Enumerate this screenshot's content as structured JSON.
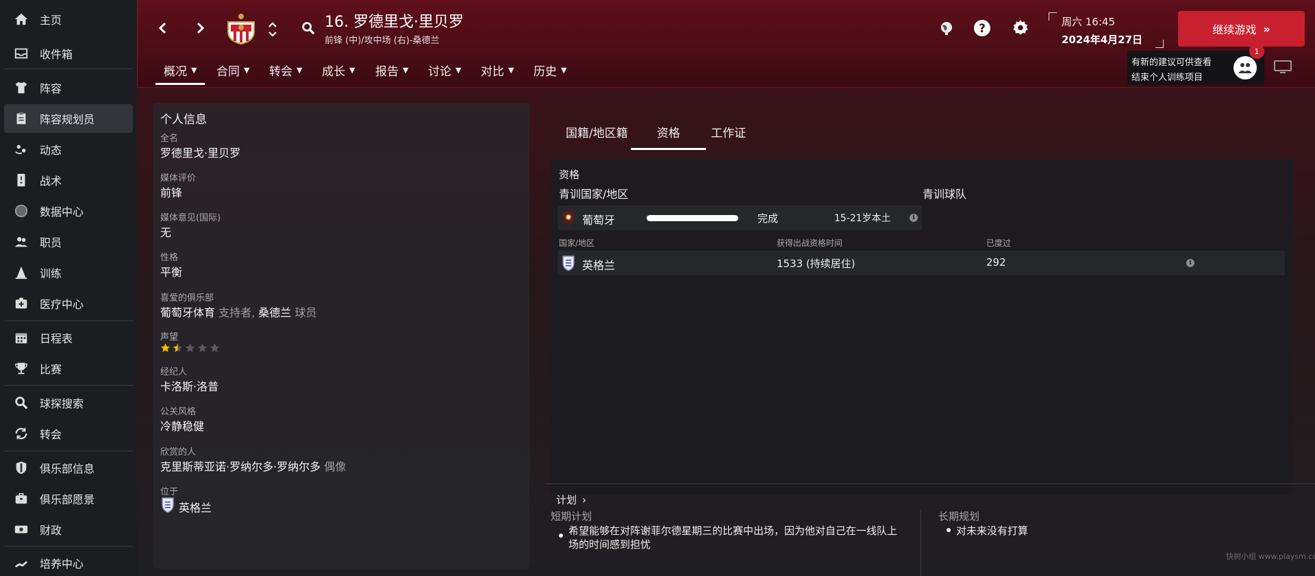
{
  "sidebar": {
    "items": [
      {
        "label": "主页",
        "icon": "home-icon"
      },
      {
        "label": "收件箱",
        "icon": "inbox-icon"
      },
      {
        "label": "阵容",
        "icon": "shirt-icon"
      },
      {
        "label": "阵容规划员",
        "icon": "clipboard-icon"
      },
      {
        "label": "动态",
        "icon": "dynamics-icon"
      },
      {
        "label": "战术",
        "icon": "tactics-board-icon"
      },
      {
        "label": "数据中心",
        "icon": "data-hub-icon"
      },
      {
        "label": "职员",
        "icon": "staff-icon"
      },
      {
        "label": "训练",
        "icon": "training-cone-icon"
      },
      {
        "label": "医疗中心",
        "icon": "medical-kit-icon"
      },
      {
        "label": "日程表",
        "icon": "calendar-icon"
      },
      {
        "label": "比赛",
        "icon": "trophy-icon"
      },
      {
        "label": "球探搜索",
        "icon": "search-icon"
      },
      {
        "label": "转会",
        "icon": "transfer-arrows-icon"
      },
      {
        "label": "俱乐部信息",
        "icon": "club-shield-icon"
      },
      {
        "label": "俱乐部愿景",
        "icon": "briefcase-icon"
      },
      {
        "label": "财政",
        "icon": "money-icon"
      },
      {
        "label": "培养中心",
        "icon": "development-chart-icon"
      }
    ]
  },
  "header": {
    "player_title": "16. 罗德里戈·里贝罗",
    "player_subtitle": "前锋 (中)/攻中场 (右)-桑德兰",
    "day_time": "周六 16:45",
    "date": "2024年4月27日",
    "continue_label": "继续游戏",
    "notice_line1": "有新的建议可供查看",
    "notice_line2": "结束个人训练项目",
    "notice_badge": "1",
    "tabs": [
      "概况",
      "合同",
      "转会",
      "成长",
      "报告",
      "讨论",
      "对比",
      "历史"
    ]
  },
  "personal": {
    "section_title": "个人信息",
    "full_name_label": "全名",
    "full_name": "罗德里戈·里贝罗",
    "media_rating_label": "媒体评价",
    "media_rating": "前锋",
    "media_opinion_label": "媒体意见(国际)",
    "media_opinion": "无",
    "personality_label": "性格",
    "personality": "平衡",
    "fav_club_label": "喜爱的俱乐部",
    "fav_club_1": "葡萄牙体育",
    "fav_club_1_role": "支持者,",
    "fav_club_2": "桑德兰",
    "fav_club_2_role": "球员",
    "reputation_label": "声望",
    "reputation_stars": 1.5,
    "reputation_max": 5,
    "agent_label": "经纪人",
    "agent": "卡洛斯·洛普",
    "pr_style_label": "公关风格",
    "pr_style": "冷静稳健",
    "admires_label": "欣赏的人",
    "admires": "克里斯蒂亚诺·罗纳尔多·罗纳尔多",
    "admires_role": "偶像",
    "located_label": "位于",
    "located": "英格兰"
  },
  "right": {
    "tabs": [
      "国籍/地区籍",
      "资格",
      "工作证"
    ],
    "qual_title": "资格",
    "youth_nation_header": "青训国家/地区",
    "youth_club_header": "青训球队",
    "youth_row": {
      "nation": "葡萄牙",
      "status": "完成",
      "rule": "15-21岁本土",
      "progress": 1.0
    },
    "col_nation": "国家/地区",
    "col_time": "获得出战资格时间",
    "col_spent": "已度过",
    "eligibility_row": {
      "nation": "英格兰",
      "time": "1533 (持续居住)",
      "spent": "292"
    }
  },
  "plans": {
    "title": "计划",
    "short_label": "短期计划",
    "short_text": "希望能够在对阵谢菲尔德星期三的比赛中出场，因为他对自己在一线队上场的时间感到担忧",
    "long_label": "长期规划",
    "long_text": "对未来没有打算"
  },
  "watermark": "快树小组 www.playsm.cc",
  "colors": {
    "accent_red": "#c8202f",
    "header_red": "#5e0f1a",
    "sidebar_bg": "#1c1d20"
  }
}
